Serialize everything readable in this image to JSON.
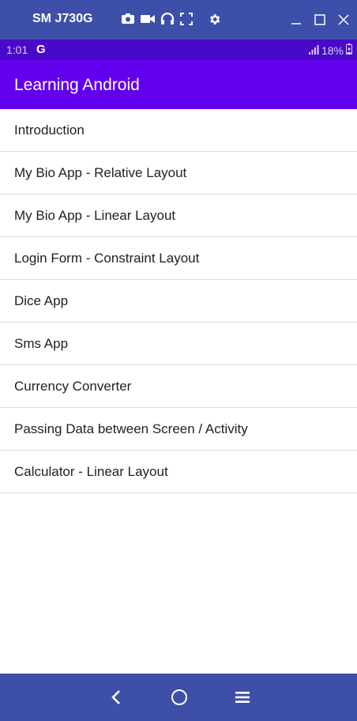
{
  "window": {
    "device_name": "SM J730G",
    "icons": [
      "camera-icon",
      "video-icon",
      "headphones-icon",
      "fullscreen-icon",
      "gear-icon"
    ],
    "controls": [
      "minimize-icon",
      "maximize-icon",
      "close-icon"
    ]
  },
  "status": {
    "time": "1:01",
    "g": "G",
    "battery": "18%"
  },
  "app": {
    "title": "Learning Android"
  },
  "list": {
    "items": [
      {
        "label": "Introduction"
      },
      {
        "label": "My Bio App - Relative Layout"
      },
      {
        "label": "My Bio App - Linear Layout"
      },
      {
        "label": "Login Form - Constraint Layout"
      },
      {
        "label": "Dice App"
      },
      {
        "label": "Sms App"
      },
      {
        "label": "Currency Converter"
      },
      {
        "label": "Passing Data between Screen / Activity"
      },
      {
        "label": "Calculator - Linear Layout"
      }
    ]
  },
  "nav": {
    "icons": [
      "back-icon",
      "home-icon",
      "menu-icon"
    ]
  },
  "colors": {
    "window_bar": "#3d4fa8",
    "status_bar": "#4a08c8",
    "app_bar": "#6200ee"
  }
}
